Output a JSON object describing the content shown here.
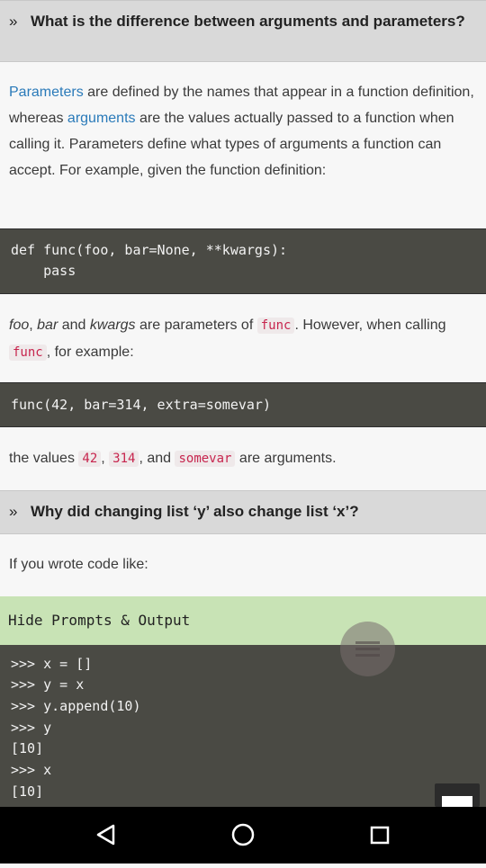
{
  "question1": {
    "chevron": "»",
    "title": "What is the difference between arguments and parameters?"
  },
  "intro": {
    "link_parameters": "Parameters",
    "text1": " are defined by the names that appear in a function definition, whereas ",
    "link_arguments": "arguments",
    "text2": " are the values actually passed to a function when calling it. Parameters define what types of arguments a function can accept. For example, given the function definition:"
  },
  "code1": {
    "line1": "def func(foo, bar=None, **kwargs):",
    "line2": "    pass"
  },
  "para2": {
    "foo": "foo",
    "sep1": ", ",
    "bar": "bar",
    "and": " and ",
    "kwargs": "kwargs",
    "text1": " are parameters of ",
    "code_func": "func",
    "text2": ". However, when calling ",
    "code_func2": "func",
    "text3": ", for example:"
  },
  "code2": {
    "line1": "func(42, bar=314, extra=somevar)"
  },
  "para3": {
    "text1": "the values ",
    "c1": "42",
    "sep1": ", ",
    "c2": "314",
    "sep2": ", and ",
    "c3": "somevar",
    "text2": " are arguments."
  },
  "question2": {
    "chevron": "»",
    "title": "Why did changing list ‘y’ also change list ‘x’?"
  },
  "para4": {
    "text": "If you wrote code like:"
  },
  "toggle": {
    "label": "Hide Prompts & Output"
  },
  "code3": {
    "lines": [
      ">>> x = []",
      ">>> y = x",
      ">>> y.append(10)",
      ">>> y",
      "[10]",
      ">>> x",
      "[10]"
    ]
  },
  "icons": {
    "fab": "menu-icon",
    "back": "back-icon",
    "home": "home-icon",
    "recents": "recents-icon"
  }
}
